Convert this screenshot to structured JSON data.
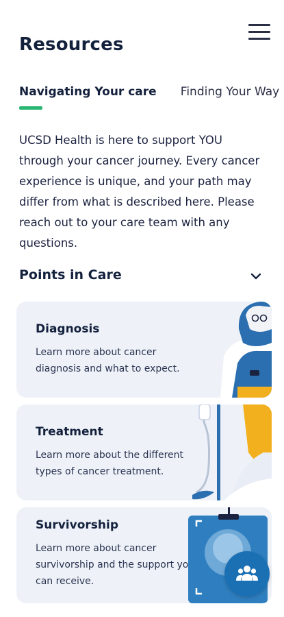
{
  "header": {
    "title": "Resources",
    "menu_icon": "hamburger-menu-icon"
  },
  "tabs": [
    {
      "label": "Navigating Your care",
      "active": true
    },
    {
      "label": "Finding Your Way",
      "active": false
    }
  ],
  "intro_text": "UCSD Health is here to support YOU through your cancer journey. Every cancer experience is unique, and your path may differ from what is described here. Please reach out to your care team with any questions.",
  "section": {
    "title": "Points in Care",
    "icon": "chevron-down-icon"
  },
  "cards": [
    {
      "title": "Diagnosis",
      "description": "Learn more about cancer diagnosis and what to expect."
    },
    {
      "title": "Treatment",
      "description": "Learn more about the different types of cancer treatment."
    },
    {
      "title": "Survivorship",
      "description": "Learn more about cancer survivorship and the support you can receive."
    }
  ],
  "fab": {
    "icon": "people-group-icon"
  },
  "colors": {
    "accent_green": "#2bb673",
    "card_bg": "#eef2f8",
    "primary_blue": "#1b6fb3",
    "title_navy": "#14213d"
  }
}
